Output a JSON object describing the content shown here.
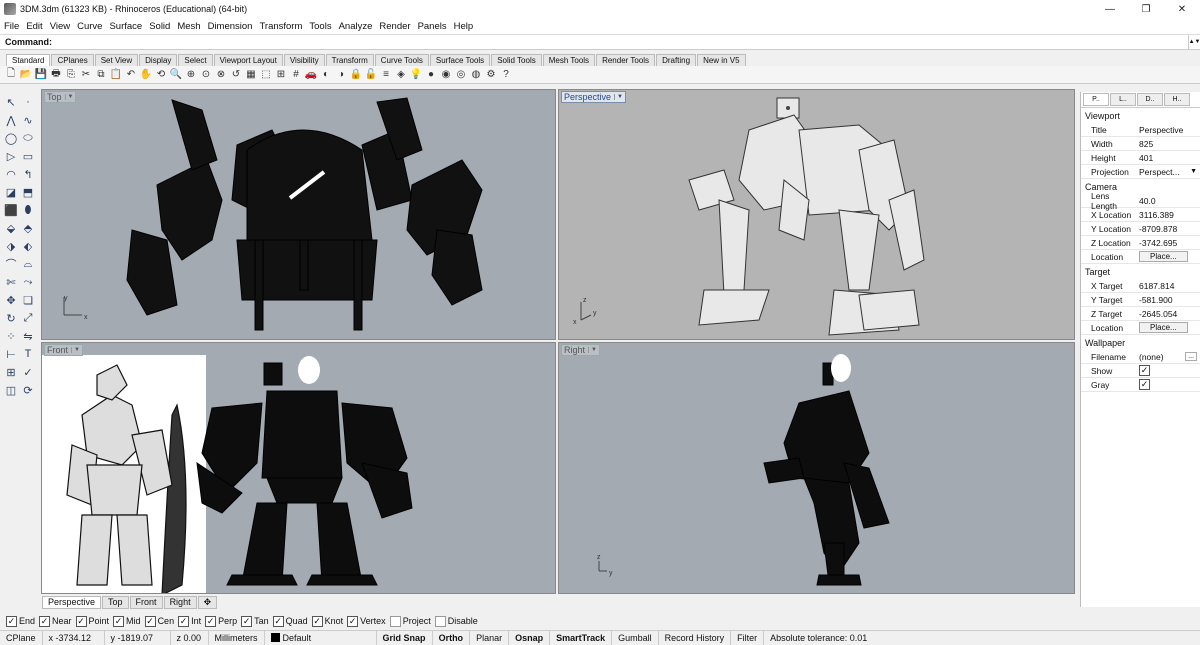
{
  "window": {
    "title": "3DM.3dm (61323 KB) - Rhinoceros (Educational) (64-bit)",
    "controls": [
      "—",
      "❐",
      "✕"
    ]
  },
  "menu": [
    "File",
    "Edit",
    "View",
    "Curve",
    "Surface",
    "Solid",
    "Mesh",
    "Dimension",
    "Transform",
    "Tools",
    "Analyze",
    "Render",
    "Panels",
    "Help"
  ],
  "command": {
    "label": "Command:",
    "value": ""
  },
  "toolbar_tabs": [
    "Standard",
    "CPlanes",
    "Set View",
    "Display",
    "Select",
    "Viewport Layout",
    "Visibility",
    "Transform",
    "Curve Tools",
    "Surface Tools",
    "Solid Tools",
    "Mesh Tools",
    "Render Tools",
    "Drafting",
    "New in V5"
  ],
  "toolbar_tab_active": "Standard",
  "viewports": {
    "top": {
      "label": "Top"
    },
    "perspective": {
      "label": "Perspective"
    },
    "front": {
      "label": "Front"
    },
    "right": {
      "label": "Right"
    }
  },
  "axes": {
    "x": "x",
    "y": "y",
    "z": "z"
  },
  "viewport_tabs": [
    "Perspective",
    "Top",
    "Front",
    "Right"
  ],
  "viewport_tab_active": "Perspective",
  "panel": {
    "tabs": [
      "P..",
      "L..",
      "D..",
      "H.."
    ],
    "viewport_section": "Viewport",
    "viewport": [
      {
        "k": "Title",
        "v": "Perspective"
      },
      {
        "k": "Width",
        "v": "825"
      },
      {
        "k": "Height",
        "v": "401"
      },
      {
        "k": "Projection",
        "v": "Perspect..."
      }
    ],
    "camera_section": "Camera",
    "camera": [
      {
        "k": "Lens Length",
        "v": "40.0"
      },
      {
        "k": "X Location",
        "v": "3116.389"
      },
      {
        "k": "Y Location",
        "v": "-8709.878"
      },
      {
        "k": "Z Location",
        "v": "-3742.695"
      },
      {
        "k": "Location",
        "v": "Place..."
      }
    ],
    "target_section": "Target",
    "target": [
      {
        "k": "X Target",
        "v": "6187.814"
      },
      {
        "k": "Y Target",
        "v": "-581.900"
      },
      {
        "k": "Z Target",
        "v": "-2645.054"
      },
      {
        "k": "Location",
        "v": "Place..."
      }
    ],
    "wallpaper_section": "Wallpaper",
    "wallpaper": [
      {
        "k": "Filename",
        "v": "(none)"
      },
      {
        "k": "Show",
        "v": "✓"
      },
      {
        "k": "Gray",
        "v": "✓"
      }
    ]
  },
  "osnaps": [
    {
      "label": "End",
      "on": true
    },
    {
      "label": "Near",
      "on": true
    },
    {
      "label": "Point",
      "on": true
    },
    {
      "label": "Mid",
      "on": true
    },
    {
      "label": "Cen",
      "on": true
    },
    {
      "label": "Int",
      "on": true
    },
    {
      "label": "Perp",
      "on": true
    },
    {
      "label": "Tan",
      "on": true
    },
    {
      "label": "Quad",
      "on": true
    },
    {
      "label": "Knot",
      "on": true
    },
    {
      "label": "Vertex",
      "on": true
    },
    {
      "label": "Project",
      "on": false
    },
    {
      "label": "Disable",
      "on": false
    }
  ],
  "status": {
    "cplane": "CPlane",
    "x": "x -3734.12",
    "y": "y -1819.07",
    "z": "z 0.00",
    "units": "Millimeters",
    "layer": "Default",
    "grid_snap": "Grid Snap",
    "ortho": "Ortho",
    "planar": "Planar",
    "osnap": "Osnap",
    "smarttrack": "SmartTrack",
    "gumball": "Gumball",
    "record_history": "Record History",
    "filter": "Filter",
    "tolerance": "Absolute tolerance: 0.01"
  },
  "colors": {
    "viewport_bg": "#a3aab2",
    "active_viewport_bg": "#b4b4b4",
    "model": "#111111"
  }
}
